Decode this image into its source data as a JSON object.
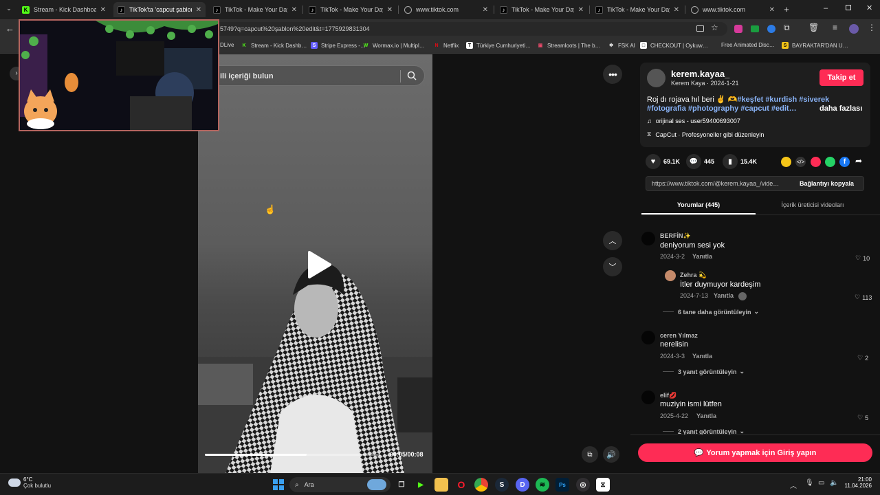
{
  "browser": {
    "tabs": [
      {
        "title": "Stream - Kick Dashboard",
        "icon": "kick-icon",
        "active": false
      },
      {
        "title": "TikTok'ta 'capcut şablon e…",
        "icon": "tiktok-icon",
        "active": true
      },
      {
        "title": "TikTok - Make Your Day",
        "icon": "tiktok-icon",
        "active": false
      },
      {
        "title": "TikTok - Make Your Day",
        "icon": "tiktok-icon",
        "active": false
      },
      {
        "title": "www.tiktok.com",
        "icon": "globe-icon",
        "active": false
      },
      {
        "title": "TikTok - Make Your Day",
        "icon": "tiktok-icon",
        "active": false
      },
      {
        "title": "TikTok - Make Your Day",
        "icon": "tiktok-icon",
        "active": false
      },
      {
        "title": "www.tiktok.com",
        "icon": "globe-icon",
        "active": false
      }
    ],
    "url_fragment": "5749?q=capcut%20şablon%20edit&t=1775929831304",
    "bookmarks": [
      {
        "label": "DLive",
        "icon": ""
      },
      {
        "label": "Stream - Kick Dashb…",
        "icon": "K"
      },
      {
        "label": "Stripe Express -…",
        "icon": "S"
      },
      {
        "label": "Wormax.io | Multipl…",
        "icon": "W"
      },
      {
        "label": "Netflix",
        "icon": "N"
      },
      {
        "label": "Türkiye Cumhuriyeti…",
        "icon": "T"
      },
      {
        "label": "Streamloots | The b…",
        "icon": "▣"
      },
      {
        "label": "FSK AI",
        "icon": "✲"
      },
      {
        "label": "CHECKOUT | Oykuw…",
        "icon": "□"
      },
      {
        "label": "Free Animated Disc…",
        "icon": ""
      },
      {
        "label": "BAYRAKTAR'DAN U…",
        "icon": "S"
      }
    ]
  },
  "video": {
    "search_placeholder": "ili içeriği bulun",
    "timecode": "00:05/00:08",
    "progress": 0.58
  },
  "post": {
    "username": "kerem.kayaa_",
    "display_name_date": "Kerem Kaya · 2024-1-21",
    "follow_label": "Takip et",
    "caption_line1_text": "Roj dı rojava hıl beri ✌️ 🫶",
    "caption_line1_tags": "#keşfet #kurdish #siverek",
    "caption_line2_tags": "#fotografia #photography #capcut #edit…",
    "more_label": "daha fazlası",
    "music": "orijinal ses - user59400693007",
    "capcut": "CapCut · Profesyoneller gibi düzenleyin",
    "likes": "69.1K",
    "comments": "445",
    "saves": "15.4K",
    "link": "https://www.tiktok.com/@kerem.kayaa_/vide…",
    "copy_link_label": "Bağlantıyı kopyala",
    "tab_comments": "Yorumlar (445)",
    "tab_creator_videos": "İçerik üreticisi videoları",
    "login_cta": "Yorum yapmak için Giriş yapın"
  },
  "comments": [
    {
      "name": "BERFİN✨",
      "text": "deniyorum sesi yok",
      "date": "2024-3-2",
      "reply": "Yanıtla",
      "likes": "10"
    },
    {
      "name": "Zehra 💫",
      "text": "İtler duymuyor kardeşim",
      "date": "2024-7-13",
      "reply": "Yanıtla",
      "likes": "113"
    },
    {
      "name": "ceren Yılmaz",
      "text": "nerelisin",
      "date": "2024-3-3",
      "reply": "Yanıtla",
      "likes": "2"
    },
    {
      "name": "elif💋",
      "text": "muziyin ismi lütfen",
      "date": "2025-4-22",
      "reply": "Yanıtla",
      "likes": "5"
    }
  ],
  "more_replies": [
    "6 tane daha görüntüleyin",
    "3 yanıt görüntüleyin",
    "2 yanıt görüntüleyin"
  ],
  "taskbar": {
    "weather_temp": "6°C",
    "weather_desc": "Çok bulutlu",
    "search_label": "Ara",
    "time": "21:00",
    "date": "11.04.2026"
  },
  "colors": {
    "accent": "#fe2c55",
    "hashtag": "#8ab4f8"
  }
}
